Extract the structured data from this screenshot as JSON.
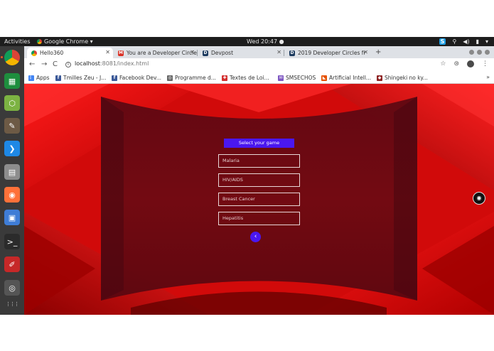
{
  "system_bar": {
    "activities": "Activities",
    "app_menu": "Google Chrome ▾",
    "clock": "Wed 20:47 ●",
    "tray": {
      "skype": "S",
      "wifi": "⚲",
      "volume": "◀)",
      "battery": "▮",
      "power": "▾"
    }
  },
  "dock": {
    "apps": [
      {
        "name": "chrome-icon",
        "glyph": "",
        "color": "#db4437"
      },
      {
        "name": "spreadsheet-icon",
        "glyph": "▦",
        "color": "#1e8e3e"
      },
      {
        "name": "cube-icon",
        "glyph": "⬡",
        "color": "#7cb342"
      },
      {
        "name": "gimp-icon",
        "glyph": "✎",
        "color": "#6d5a45"
      },
      {
        "name": "vscode-icon",
        "glyph": "❯",
        "color": "#1e88e5"
      },
      {
        "name": "files-icon",
        "glyph": "▤",
        "color": "#8d8d8d"
      },
      {
        "name": "firefox-icon",
        "glyph": "◉",
        "color": "#ff7139"
      },
      {
        "name": "image-viewer-icon",
        "glyph": "▣",
        "color": "#3f7dd6"
      },
      {
        "name": "terminal-icon",
        "glyph": ">_",
        "color": "#2b2b2b"
      },
      {
        "name": "text-editor-icon",
        "glyph": "✐",
        "color": "#c62828"
      },
      {
        "name": "disk-icon",
        "glyph": "◎",
        "color": "#555555"
      },
      {
        "name": "show-apps-icon",
        "glyph": "⋮⋮⋮",
        "color": "#3a3a3a"
      }
    ]
  },
  "tabs": [
    {
      "label": "Hello360",
      "favicon": "",
      "color": "#4285f4",
      "active": true
    },
    {
      "label": "You are a Developer Circle",
      "favicon": "M",
      "color": "#d93025",
      "active": false
    },
    {
      "label": "Devpost",
      "favicon": "D",
      "color": "#1c3a5e",
      "active": false
    },
    {
      "label": "2019 Developer Circles fr",
      "favicon": "D",
      "color": "#1c3a5e",
      "active": false
    }
  ],
  "new_tab": "+",
  "toolbar": {
    "back": "←",
    "forward": "→",
    "reload": "C",
    "url_host": "localhost",
    "url_path": ":8081/index.html",
    "star": "☆",
    "menu": "⋮"
  },
  "bookmarks": [
    {
      "label": "Apps",
      "icon": "⋮⋮",
      "color": "#4285f4"
    },
    {
      "label": "Tmilles Zeu - J...",
      "icon": "f",
      "color": "#3b5998"
    },
    {
      "label": "Facebook Dev...",
      "icon": "f",
      "color": "#3b5998"
    },
    {
      "label": "Programme d...",
      "icon": "◎",
      "color": "#666666"
    },
    {
      "label": "Textes de Loi...",
      "icon": "✚",
      "color": "#d32f2f"
    },
    {
      "label": "SMSECHOS",
      "icon": "✉",
      "color": "#7e57c2"
    },
    {
      "label": "Artificial Intell...",
      "icon": "◣",
      "color": "#e65100"
    },
    {
      "label": "Shingeki no ky...",
      "icon": "◆",
      "color": "#8e2424"
    }
  ],
  "bookmarks_more": "»",
  "game_menu": {
    "heading": "Select your game",
    "options": [
      "Malaria",
      "HIV/AIDS",
      "Breast Cancer",
      "Hepatitis"
    ],
    "back_glyph": "‹"
  },
  "vr_button": "◉",
  "colors": {
    "accent": "#4a17f0",
    "background_red": "#d60a0a",
    "panel": "#6a0810"
  }
}
